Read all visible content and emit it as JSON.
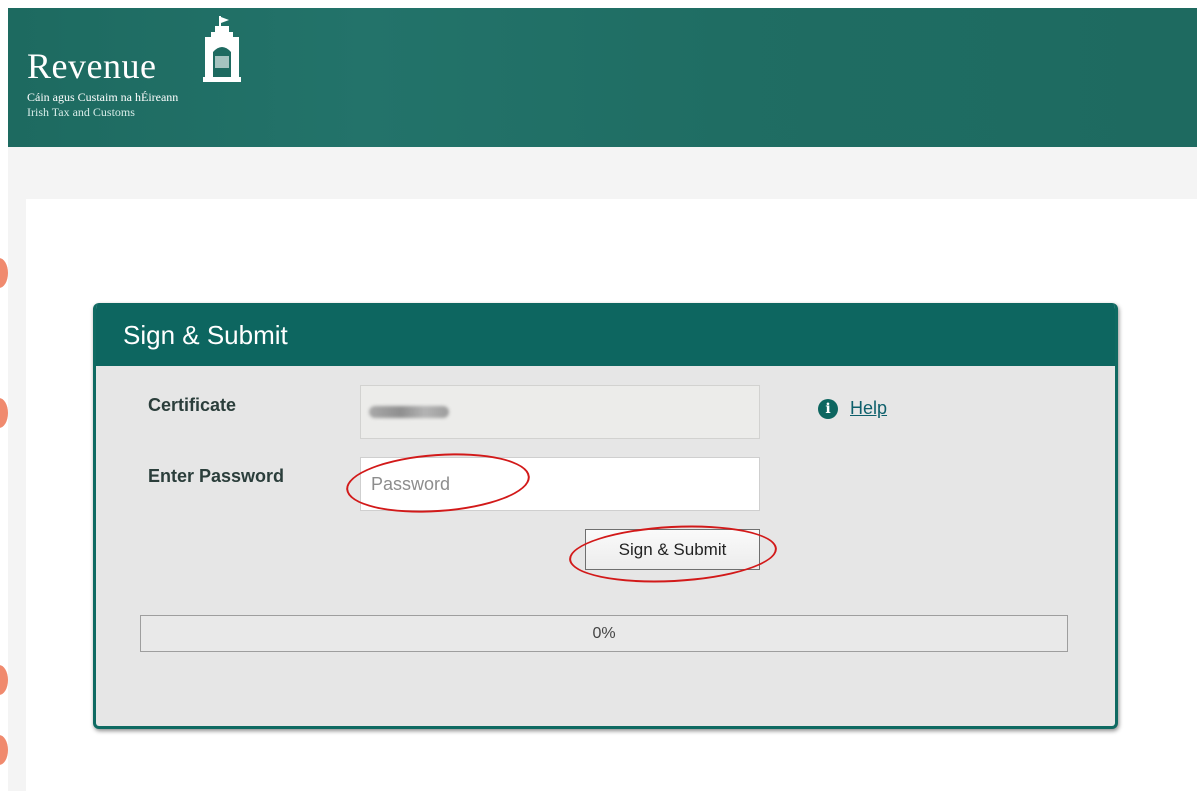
{
  "header": {
    "brand": "Revenue",
    "subtitle_irish": "Cáin agus Custaim na hÉireann",
    "subtitle_english": "Irish Tax and Customs",
    "logo_icon": "custom-house-tower-icon",
    "background_color": "#1e6a60"
  },
  "panel": {
    "title": "Sign & Submit",
    "header_color": "#0d6660",
    "certificate": {
      "label": "Certificate",
      "value_obscured": true
    },
    "password": {
      "label": "Enter Password",
      "placeholder": "Password",
      "value": ""
    },
    "help": {
      "icon": "info-icon",
      "icon_glyph": "i",
      "label": "Help"
    },
    "submit_button": {
      "label": "Sign & Submit"
    },
    "progress": {
      "percent": 0,
      "label": "0%"
    }
  },
  "annotations": {
    "color": "#d21919",
    "highlighted": [
      "Password",
      "Sign & Submit"
    ]
  }
}
